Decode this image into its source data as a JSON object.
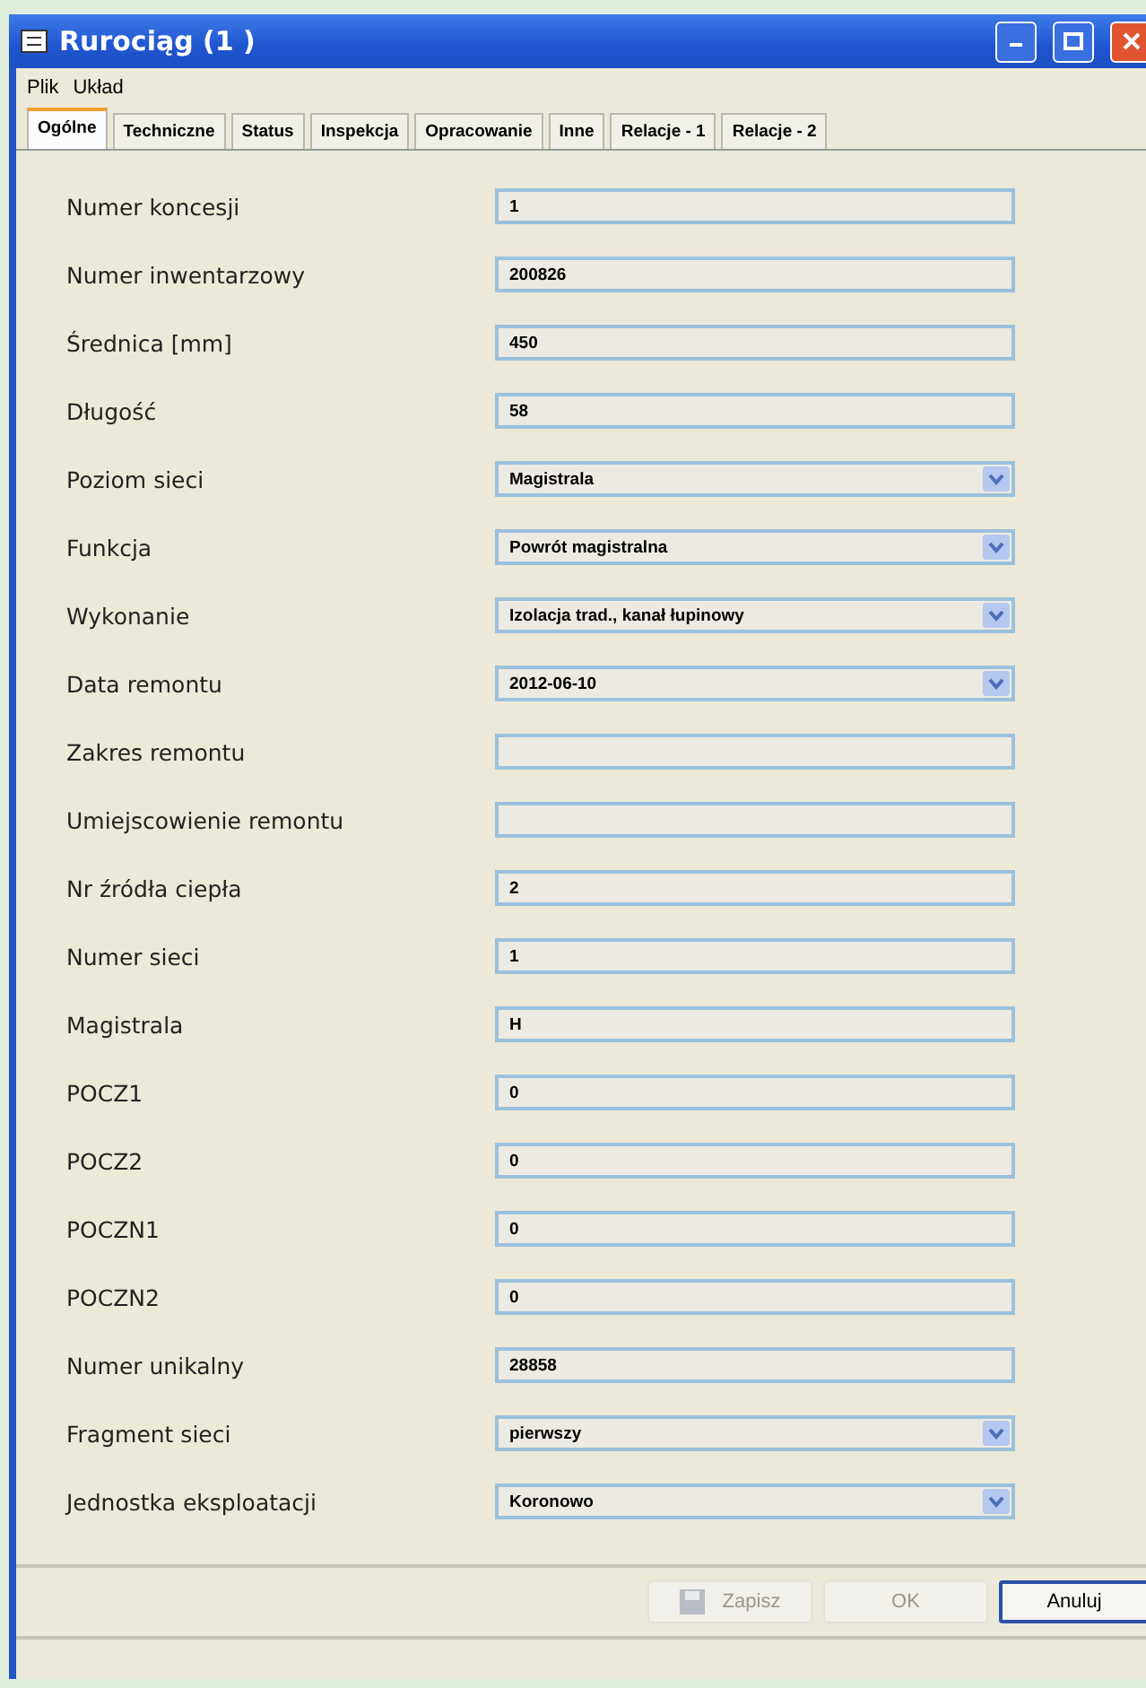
{
  "window": {
    "title": "Rurociąg (1 )"
  },
  "menu": [
    "Plik",
    "Układ"
  ],
  "tabs": [
    {
      "label": "Ogólne",
      "selected": true
    },
    {
      "label": "Techniczne",
      "selected": false
    },
    {
      "label": "Status",
      "selected": false
    },
    {
      "label": "Inspekcja",
      "selected": false
    },
    {
      "label": "Opracowanie",
      "selected": false
    },
    {
      "label": "Inne",
      "selected": false
    },
    {
      "label": "Relacje - 1",
      "selected": false
    },
    {
      "label": "Relacje - 2",
      "selected": false
    }
  ],
  "fields": [
    {
      "label": "Numer koncesji",
      "kind": "text",
      "value": "1"
    },
    {
      "label": "Numer inwentarzowy",
      "kind": "text",
      "value": "200826"
    },
    {
      "label": "Średnica [mm]",
      "kind": "text",
      "value": "450"
    },
    {
      "label": "Długość",
      "kind": "text",
      "value": "58"
    },
    {
      "label": "Poziom sieci",
      "kind": "select",
      "value": "Magistrala"
    },
    {
      "label": "Funkcja",
      "kind": "select",
      "value": "Powrót magistralna"
    },
    {
      "label": "Wykonanie",
      "kind": "select",
      "value": "Izolacja trad., kanał łupinowy"
    },
    {
      "label": "Data remontu",
      "kind": "select",
      "value": "2012-06-10"
    },
    {
      "label": "Zakres remontu",
      "kind": "text"
    },
    {
      "label": "Umiejscowienie remontu",
      "kind": "text"
    },
    {
      "label": "Nr źródła ciepła",
      "kind": "text",
      "value": "2"
    },
    {
      "label": "Numer sieci",
      "kind": "text",
      "value": "1"
    },
    {
      "label": "Magistrala",
      "kind": "text",
      "value": "H"
    },
    {
      "label": "POCZ1",
      "kind": "text",
      "value": "0"
    },
    {
      "label": "POCZ2",
      "kind": "text",
      "value": "0"
    },
    {
      "label": "POCZN1",
      "kind": "text",
      "value": "0"
    },
    {
      "label": "POCZN2",
      "kind": "text",
      "value": "0"
    },
    {
      "label": "Numer unikalny",
      "kind": "text",
      "value": "28858"
    },
    {
      "label": "Fragment sieci",
      "kind": "select",
      "value": "pierwszy"
    },
    {
      "label": "Jednostka eksploatacji",
      "kind": "select",
      "value": "Koronowo"
    }
  ],
  "buttons": [
    {
      "label": "Zapisz",
      "kind": "save",
      "disabled": true
    },
    {
      "label": "OK",
      "kind": "plain",
      "disabled": true
    },
    {
      "label": "Anuluj",
      "kind": "plain",
      "disabled": false
    }
  ]
}
